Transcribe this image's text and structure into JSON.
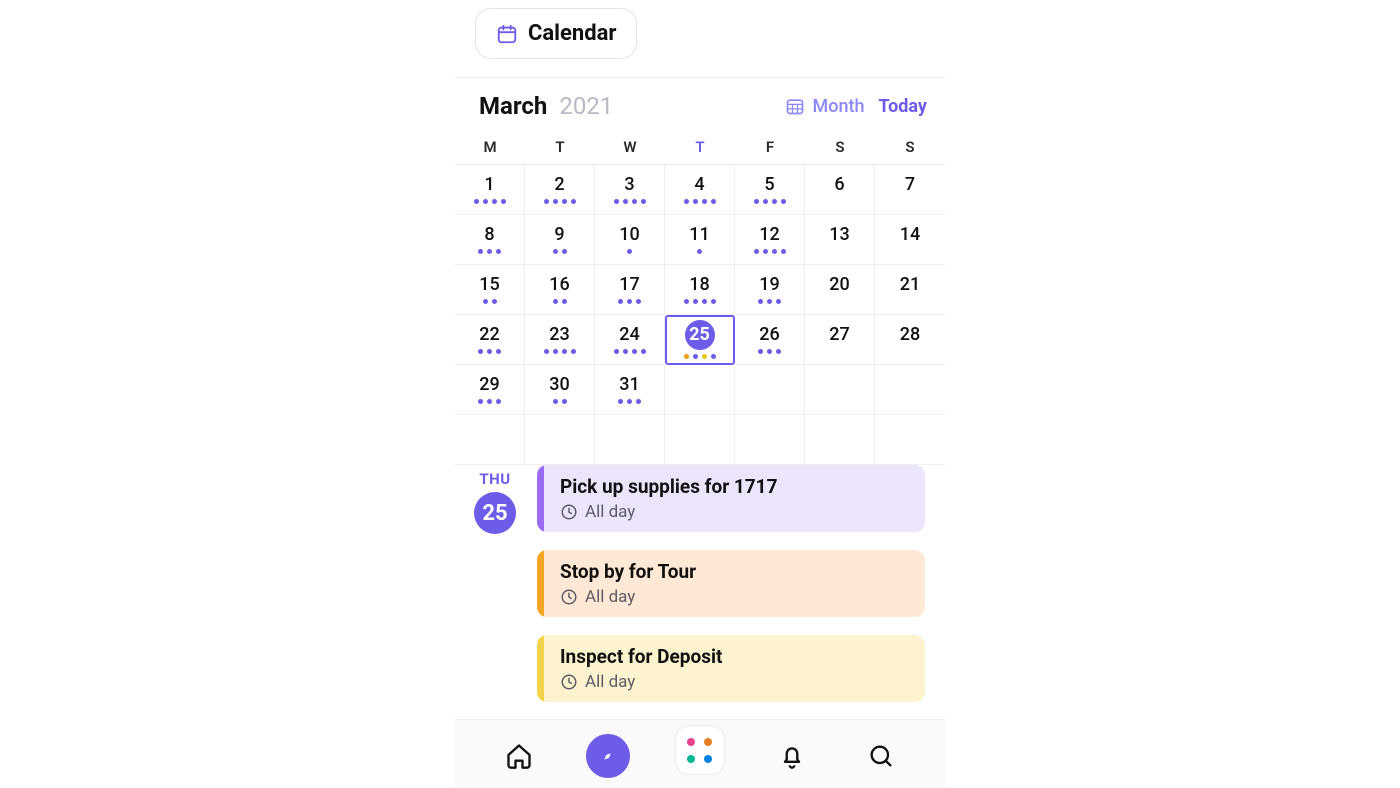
{
  "header": {
    "chip_label": "Calendar",
    "month": "March",
    "year": "2021",
    "mode_label": "Month",
    "today_label": "Today"
  },
  "weekdays": [
    "M",
    "T",
    "W",
    "T",
    "F",
    "S",
    "S"
  ],
  "today_weekday_index": 3,
  "selected_day": 25,
  "calendar_rows": [
    [
      {
        "n": 1,
        "dots": 4
      },
      {
        "n": 2,
        "dots": 4
      },
      {
        "n": 3,
        "dots": 4
      },
      {
        "n": 4,
        "dots": 4
      },
      {
        "n": 5,
        "dots": 4
      },
      {
        "n": 6,
        "dots": 0
      },
      {
        "n": 7,
        "dots": 0
      }
    ],
    [
      {
        "n": 8,
        "dots": 3
      },
      {
        "n": 9,
        "dots": 2
      },
      {
        "n": 10,
        "dots": 1
      },
      {
        "n": 11,
        "dots": 1
      },
      {
        "n": 12,
        "dots": 4
      },
      {
        "n": 13,
        "dots": 0
      },
      {
        "n": 14,
        "dots": 0
      }
    ],
    [
      {
        "n": 15,
        "dots": 2
      },
      {
        "n": 16,
        "dots": 2
      },
      {
        "n": 17,
        "dots": 3
      },
      {
        "n": 18,
        "dots": 4
      },
      {
        "n": 19,
        "dots": 3
      },
      {
        "n": 20,
        "dots": 0
      },
      {
        "n": 21,
        "dots": 0
      }
    ],
    [
      {
        "n": 22,
        "dots": 3
      },
      {
        "n": 23,
        "dots": 4
      },
      {
        "n": 24,
        "dots": 4
      },
      {
        "n": 25,
        "dots": 4,
        "selected": true,
        "dot_colors": [
          "orange",
          "purple",
          "yellow",
          "purple"
        ]
      },
      {
        "n": 26,
        "dots": 3
      },
      {
        "n": 27,
        "dots": 0
      },
      {
        "n": 28,
        "dots": 0
      }
    ],
    [
      {
        "n": 29,
        "dots": 3
      },
      {
        "n": 30,
        "dots": 2
      },
      {
        "n": 31,
        "dots": 3
      },
      {
        "n": null
      },
      {
        "n": null
      },
      {
        "n": null
      },
      {
        "n": null
      }
    ],
    [
      {
        "n": null
      },
      {
        "n": null
      },
      {
        "n": null
      },
      {
        "n": null
      },
      {
        "n": null
      },
      {
        "n": null
      },
      {
        "n": null
      }
    ]
  ],
  "day_label": {
    "dow": "THU",
    "day": "25"
  },
  "events": [
    {
      "title": "Pick up supplies for 1717",
      "time": "All day",
      "color": "purple"
    },
    {
      "title": "Stop by for Tour",
      "time": "All day",
      "color": "orange"
    },
    {
      "title": "Inspect for Deposit",
      "time": "All day",
      "color": "yellow"
    }
  ],
  "tabs": [
    "home",
    "explore",
    "apps",
    "notifications",
    "search"
  ],
  "active_tab": "explore"
}
